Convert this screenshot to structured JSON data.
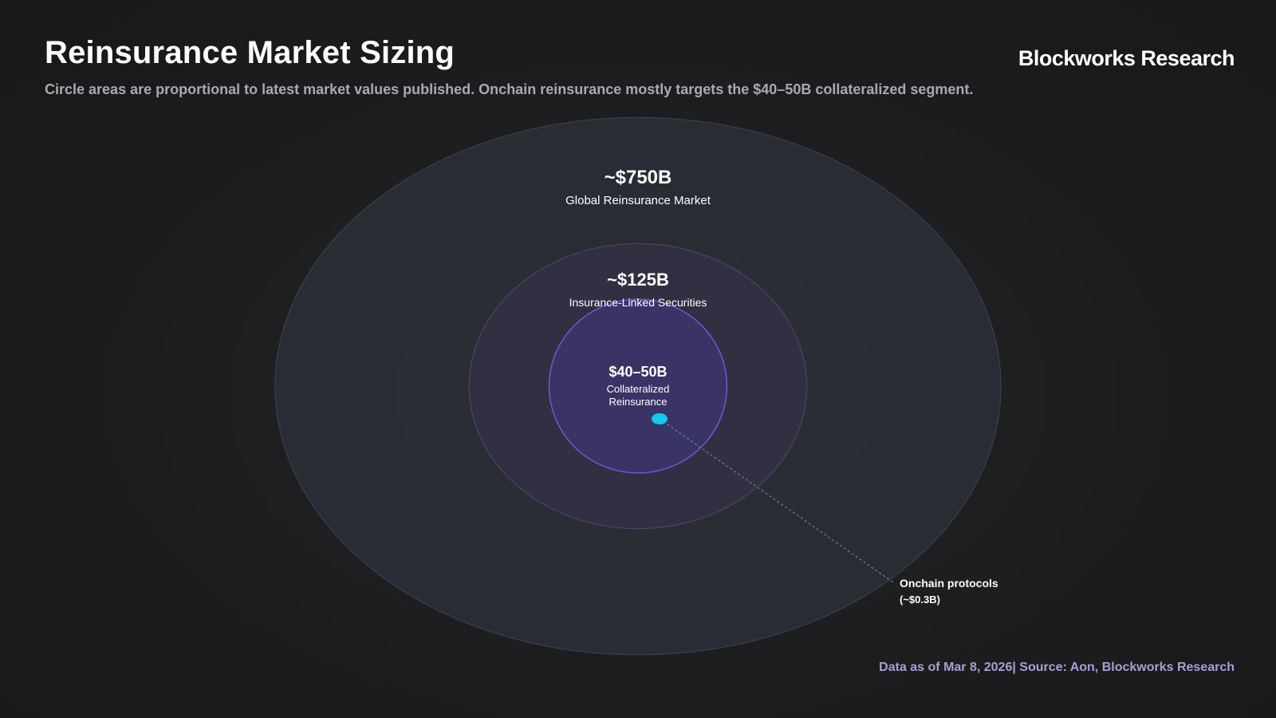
{
  "header": {
    "title": "Reinsurance Market Sizing",
    "subtitle": "Circle areas are proportional to latest market values published. Onchain reinsurance mostly targets the $40–50B collateralized segment.",
    "brand": "Blockworks Research"
  },
  "footer": {
    "source": "Data as of Mar 8, 2026| Source: Aon, Blockworks Research"
  },
  "colors": {
    "outer_fill": "#2a2f37",
    "outer_stroke": "#3a4050",
    "middle_fill": "#332f45",
    "middle_stroke": "#4b4468",
    "inner_fill": "#3b3568",
    "inner_stroke": "#6a5bd0",
    "onchain_dot": "#19c6f0",
    "leader_line": "#5a8aa8",
    "source_text": "#a99fd4"
  },
  "chart_data": {
    "type": "nested-bubble",
    "title": "Reinsurance Market Sizing",
    "subtitle": "Circle areas are proportional to latest market values published. Onchain reinsurance mostly targets the $40–50B collateralized segment.",
    "units": "USD billions",
    "segments": [
      {
        "id": "global",
        "value_label": "~$750B",
        "name": "Global Reinsurance Market",
        "value": 750
      },
      {
        "id": "ils",
        "value_label": "~$125B",
        "name": "Insurance-Linked Securities",
        "value": 125
      },
      {
        "id": "collateralized",
        "value_label": "$40–50B",
        "name_lines": [
          "Collateralized",
          "Reinsurance"
        ],
        "value": 45
      },
      {
        "id": "onchain",
        "name": "Onchain protocols",
        "value_label": "(~$0.3B)",
        "value": 0.3
      }
    ]
  }
}
